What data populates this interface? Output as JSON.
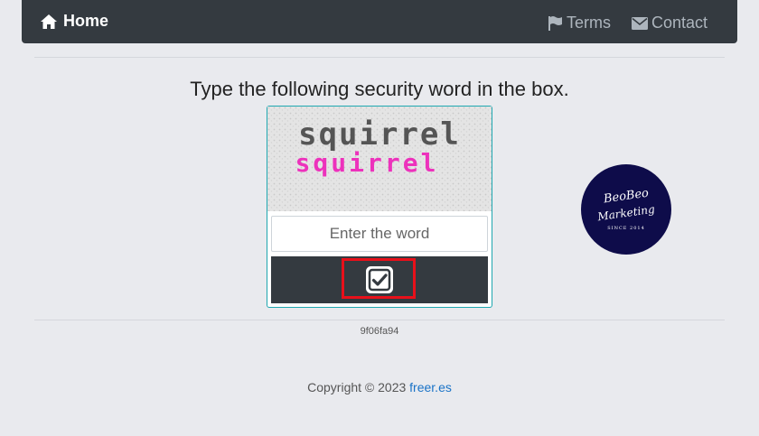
{
  "nav": {
    "home_label": "Home",
    "terms_label": "Terms",
    "contact_label": "Contact"
  },
  "prompt": "Type the following security word in the box.",
  "captcha": {
    "word_top": "squirrel",
    "word_bottom": "squirrel",
    "input_placeholder": "Enter the word",
    "input_value": ""
  },
  "token": "9f06fa94",
  "footer": {
    "copyright": "Copyright © 2023",
    "link_text": "freer.es"
  },
  "logo": {
    "line1": "BeoBeo",
    "line2": "Marketing",
    "line3": "SINCE 2014"
  },
  "colors": {
    "navbar": "#343a40",
    "captcha_border": "#1ea7b0",
    "highlight": "#e8101a",
    "link": "#1a73c7",
    "logo_bg": "#0e0c4a"
  },
  "icons": [
    "home-icon",
    "flag-icon",
    "envelope-icon",
    "checkbox-check-icon"
  ]
}
